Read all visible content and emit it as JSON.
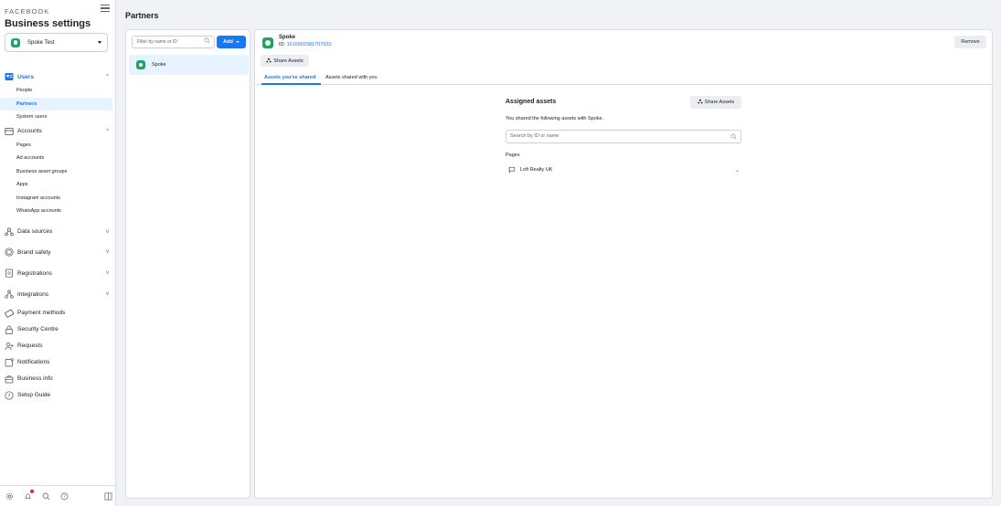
{
  "sidebar": {
    "brand": "FACEBOOK",
    "title": "Business settings",
    "account": "Spoke Test",
    "sections": [
      {
        "label": "Users",
        "icon": "users-icon",
        "chev": "^",
        "active": true,
        "subs": [
          {
            "label": "People"
          },
          {
            "label": "Partners",
            "selected": true
          },
          {
            "label": "System users"
          }
        ]
      },
      {
        "label": "Accounts",
        "icon": "accounts-icon",
        "chev": "^",
        "subs": [
          {
            "label": "Pages"
          },
          {
            "label": "Ad accounts"
          },
          {
            "label": "Business asset groups"
          },
          {
            "label": "Apps"
          },
          {
            "label": "Instagram accounts"
          },
          {
            "label": "WhatsApp accounts"
          }
        ]
      },
      {
        "label": "Data sources",
        "icon": "data-sources-icon",
        "chev": "v"
      },
      {
        "label": "Brand safety",
        "icon": "brand-safety-icon",
        "chev": "v"
      },
      {
        "label": "Registrations",
        "icon": "registrations-icon",
        "chev": "v"
      },
      {
        "label": "Integrations",
        "icon": "integrations-icon",
        "chev": "v"
      },
      {
        "label": "Payment methods",
        "icon": "payment-icon"
      },
      {
        "label": "Security Centre",
        "icon": "lock-icon"
      },
      {
        "label": "Requests",
        "icon": "requests-icon"
      },
      {
        "label": "Notifications",
        "icon": "notifications-icon"
      },
      {
        "label": "Business info",
        "icon": "briefcase-icon"
      },
      {
        "label": "Setup Guide",
        "icon": "help-icon"
      }
    ]
  },
  "page_title": "Partners",
  "list": {
    "filter_placeholder": "Filter by name or ID",
    "add_label": "Add",
    "items": [
      {
        "name": "Spoke"
      }
    ]
  },
  "detail": {
    "name": "Spoke",
    "id_prefix": "ID: ",
    "id": "1616902081707620",
    "remove_label": "Remove",
    "share_label": "Share Assets",
    "tabs": [
      "Assets you've shared",
      "Assets shared with you"
    ],
    "assigned_title": "Assigned assets",
    "share_label2": "Share Assets",
    "shared_text": "You shared the following assets with Spoke.",
    "search_placeholder": "Search by ID or name",
    "pages_label": "Pages",
    "pages": [
      {
        "name": "Loft Realty UK"
      }
    ]
  },
  "colors": {
    "accent": "#1877f2",
    "brand_green": "#1fa463",
    "selected_bg": "#e7f3ff"
  }
}
